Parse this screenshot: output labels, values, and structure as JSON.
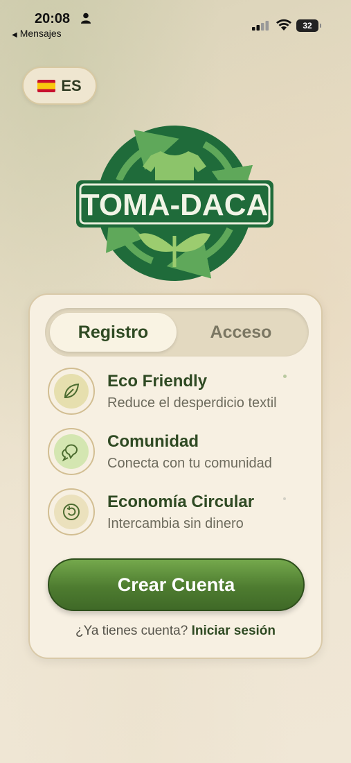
{
  "status_bar": {
    "time": "20:08",
    "back_label": "Mensajes",
    "battery": "32"
  },
  "language": {
    "code": "ES",
    "flag_icon": "spain-flag-icon"
  },
  "logo": {
    "text": "TOMA-DACA"
  },
  "tabs": [
    {
      "label": "Registro",
      "active": true
    },
    {
      "label": "Acceso",
      "active": false
    }
  ],
  "features": [
    {
      "title": "Eco Friendly",
      "description": "Reduce el desperdicio textil",
      "icon": "leaf-icon"
    },
    {
      "title": "Comunidad",
      "description": "Conecta con tu comunidad",
      "icon": "chat-bubbles-icon"
    },
    {
      "title": "Economía Circular",
      "description": "Intercambia sin dinero",
      "icon": "circular-arrow-icon"
    }
  ],
  "cta": {
    "label": "Crear Cuenta"
  },
  "signin": {
    "prompt": "¿Ya tienes cuenta?",
    "link": "Iniciar sesión"
  },
  "colors": {
    "primary_green": "#4e7c30",
    "dark_green": "#1f6b3a",
    "card_bg": "#f7f0e2"
  }
}
